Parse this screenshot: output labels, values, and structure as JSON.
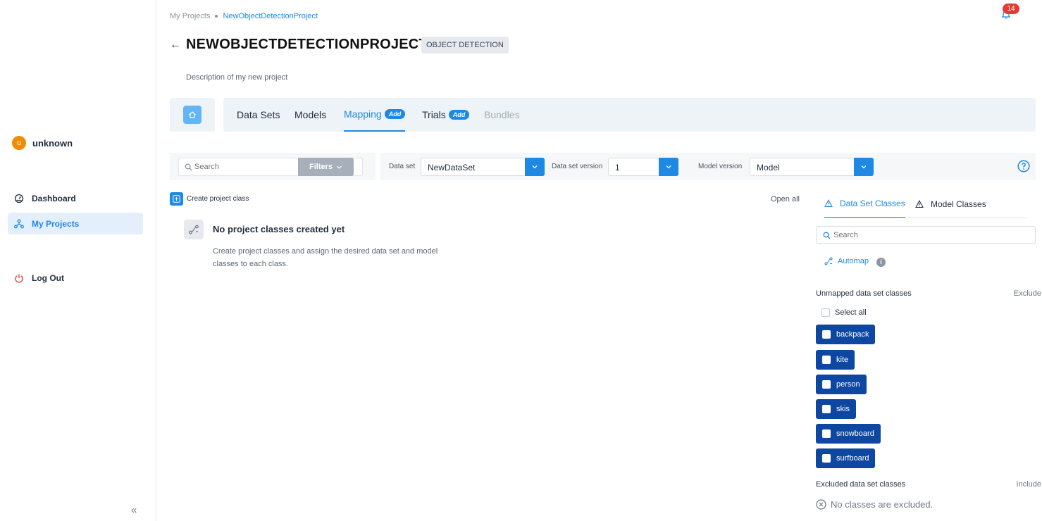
{
  "sidebar": {
    "user": {
      "initial": "u",
      "name": "unknown"
    },
    "nav": [
      {
        "label": "Dashboard",
        "icon": "gauge-icon"
      },
      {
        "label": "My Projects",
        "icon": "project-tree-icon",
        "active": true
      },
      {
        "label": "Log Out",
        "icon": "power-icon"
      }
    ],
    "collapse_glyph": "«"
  },
  "header": {
    "breadcrumb": [
      "My Projects",
      "NewObjectDetectionProject"
    ],
    "notifications_count": "14",
    "back_glyph": "←",
    "project_title": "NEWOBJECTDETECTIONPROJECT",
    "project_type": "OBJECT DETECTION",
    "description": "Description of my new project"
  },
  "tabs": [
    {
      "label": "Data Sets"
    },
    {
      "label": "Models"
    },
    {
      "label": "Mapping",
      "pill": "Add",
      "active": true
    },
    {
      "label": "Trials",
      "pill": "Add"
    },
    {
      "label": "Bundles",
      "disabled": true
    }
  ],
  "filters": {
    "search_placeholder": "Search",
    "filters_label": "Filters",
    "dataset_label": "Data set",
    "dataset_value": "NewDataSet",
    "dataset_version_label": "Data set version",
    "dataset_version_value": "1",
    "model_version_label": "Model version",
    "model_version_value": "Model"
  },
  "mapping": {
    "create_label": "Create project class",
    "open_all": "Open all",
    "empty_title": "No project classes created yet",
    "empty_text": "Create project classes and assign the desired data set and model classes to each class."
  },
  "panel": {
    "tabs": [
      "Data Set Classes",
      "Model Classes"
    ],
    "search_placeholder": "Search",
    "automap_label": "Automap",
    "info_glyph": "i",
    "unmapped_header": "Unmapped data set classes",
    "exclude_label": "Exclude",
    "select_all": "Select all",
    "classes": [
      "backpack",
      "kite",
      "person",
      "skis",
      "snowboard",
      "surfboard"
    ],
    "excluded_header": "Excluded data set classes",
    "include_label": "Include",
    "no_excluded": "No classes are excluded."
  },
  "colors": {
    "accent": "#1e88e5",
    "chip": "#0d47a1",
    "badge": "#e53935",
    "avatar": "#f08c00"
  }
}
